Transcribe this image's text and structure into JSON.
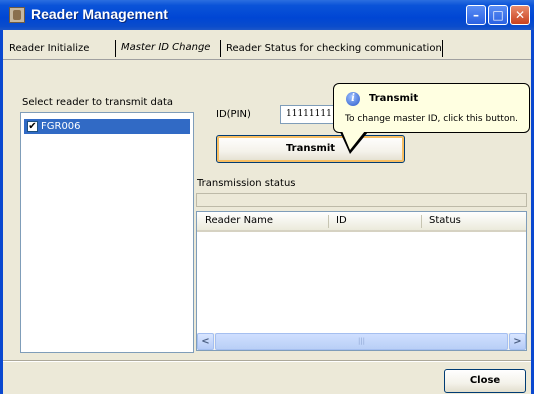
{
  "window": {
    "title": "Reader Management",
    "buttons": {
      "minimize": "–",
      "maximize": "□",
      "close": "✕"
    }
  },
  "tabs": [
    {
      "label": "Reader Initialize"
    },
    {
      "label": "Master ID Change",
      "active": true
    },
    {
      "label": "Reader Status for checking communication"
    }
  ],
  "left": {
    "select_label": "Select reader to transmit data",
    "readers": [
      {
        "name": "FGR006",
        "checked": true,
        "checkmark": "✔"
      }
    ]
  },
  "form": {
    "id_label": "ID(PIN)",
    "id_value": "11111111",
    "transmit_button": "Transmit"
  },
  "tooltip": {
    "icon": "info-icon",
    "icon_glyph": "i",
    "title": "Transmit",
    "text": "To change master ID, click this button."
  },
  "status": {
    "label": "Transmission status",
    "columns": [
      "Reader Name",
      "ID",
      "Status"
    ],
    "rows": []
  },
  "scrollbar": {
    "left_arrow": "<",
    "right_arrow": ">",
    "grip": "|||"
  },
  "footer": {
    "close_button": "Close"
  },
  "colors": {
    "titlebar": "#0046D4",
    "selection": "#316AC5",
    "tooltip_bg": "#FFFFE1"
  }
}
